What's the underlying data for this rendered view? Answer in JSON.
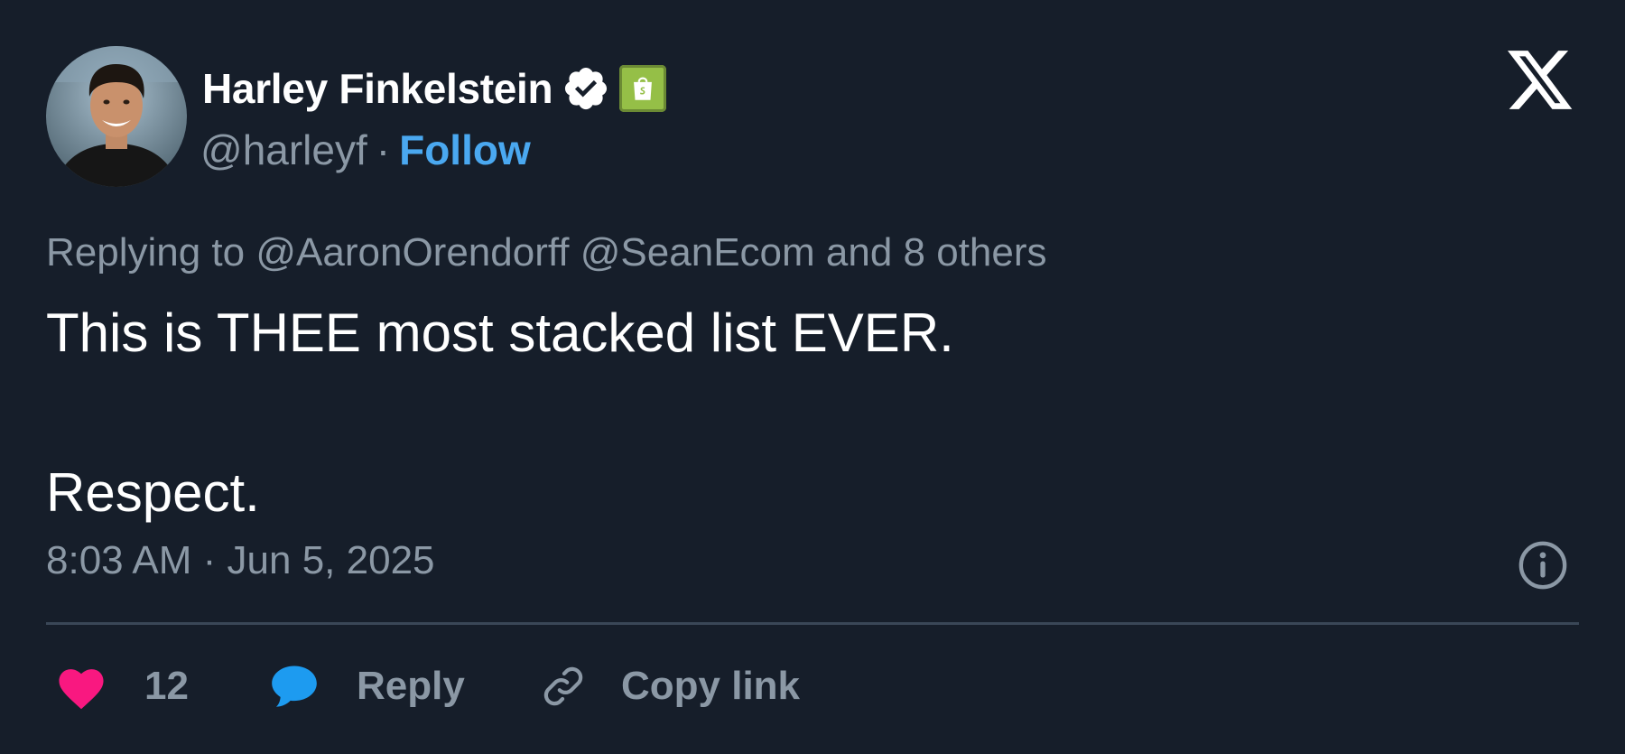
{
  "author": {
    "display_name": "Harley Finkelstein",
    "handle": "@harleyf",
    "separator": "·",
    "follow_label": "Follow",
    "verified": true,
    "affiliate_badge": "shopify-bag-icon"
  },
  "platform_logo": "x-logo-icon",
  "replying": {
    "prefix": "Replying to",
    "mention_1": "@AaronOrendorff",
    "mention_2": "@SeanEcom",
    "suffix": "and 8 others"
  },
  "tweet": {
    "line_1": "This is THEE most stacked list EVER.",
    "line_2": "Respect."
  },
  "timestamp": "8:03 AM · Jun 5, 2025",
  "actions": {
    "like_count": "12",
    "reply_label": "Reply",
    "copy_link_label": "Copy link"
  },
  "colors": {
    "background": "#161e2a",
    "primary_text": "#ffffff",
    "secondary_text": "#8b98a5",
    "follow_link": "#4aa8f0",
    "like_heart": "#f91880",
    "reply_bubble": "#1d9bf0",
    "shopify_green": "#95bf47",
    "divider": "#3a4757"
  }
}
